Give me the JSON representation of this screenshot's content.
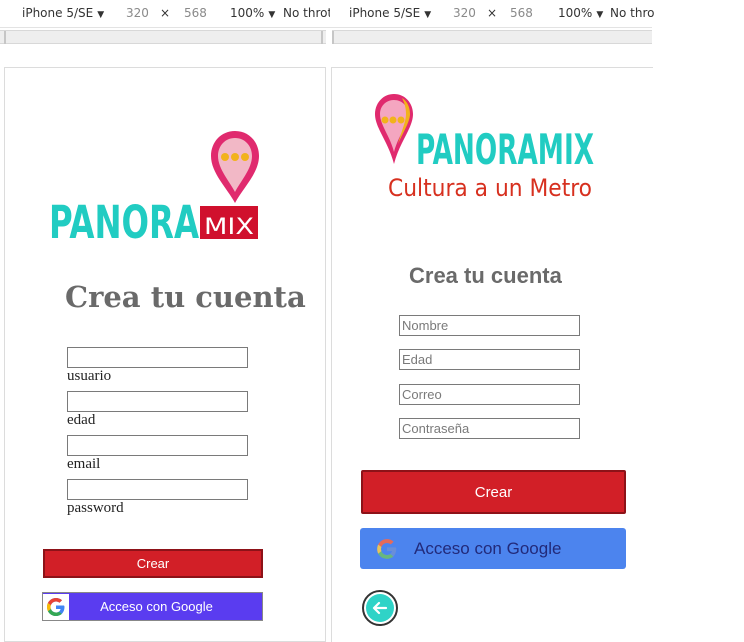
{
  "toolbars": [
    {
      "device": "iPhone 5/SE",
      "width": "320",
      "times": "×",
      "height": "568",
      "zoom": "100%",
      "throttle": "No throt"
    },
    {
      "device": "iPhone 5/SE",
      "width": "320",
      "times": "×",
      "height": "568",
      "zoom": "100%",
      "throttle": "No thro"
    }
  ],
  "left_screen": {
    "logo": {
      "word_main": "PANORA",
      "word_mix": "MIX",
      "colors": {
        "teal": "#21ccc2",
        "red": "#d0102d",
        "pin": "#e02a6e"
      }
    },
    "heading": "Crea tu cuenta",
    "fields": [
      {
        "label": "usuario"
      },
      {
        "label": "edad"
      },
      {
        "label": "email"
      },
      {
        "label": "password"
      }
    ],
    "create_button": "Crear",
    "google_button": "Acceso con Google"
  },
  "right_screen": {
    "logo": {
      "word": "PANORAMIX",
      "tagline": "Cultura a un Metro",
      "colors": {
        "teal": "#21ccc2",
        "red": "#d7301f"
      }
    },
    "heading": "Crea tu cuenta",
    "fields": [
      {
        "placeholder": "Nombre"
      },
      {
        "placeholder": "Edad"
      },
      {
        "placeholder": "Correo"
      },
      {
        "placeholder": "Contraseña"
      }
    ],
    "create_button": "Crear",
    "google_button": "Acceso con Google",
    "back_icon": "arrow-left-icon"
  },
  "colors": {
    "accent_red": "#d21f27",
    "google_blue": "#4c84ee",
    "google_purple": "#5a3cf0",
    "heading_gray": "#6a6a6a"
  }
}
